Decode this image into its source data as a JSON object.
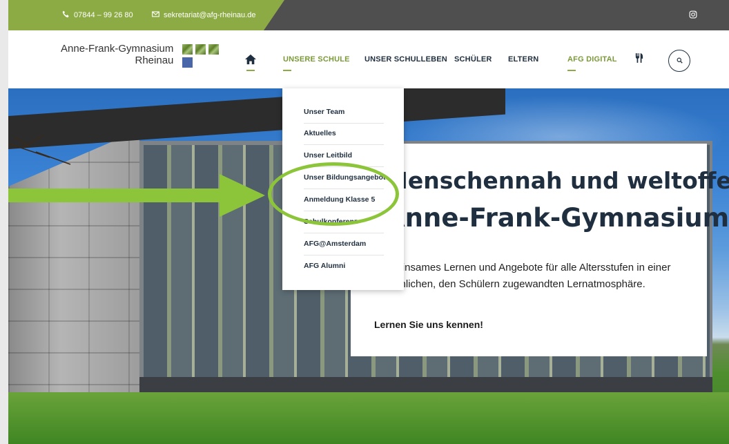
{
  "topbar": {
    "phone": "07844 – 99 26 80",
    "email": "sekretariat@afg-rheinau.de",
    "icons": {
      "phone": "phone-icon",
      "email": "mail-icon",
      "social": "instagram-icon"
    }
  },
  "logo": {
    "line1": "Anne-Frank-Gymnasium",
    "line2": "Rheinau"
  },
  "nav": {
    "home_icon": "home-icon",
    "items": [
      {
        "label": "UNSERE SCHULE",
        "active": true
      },
      {
        "label": "UNSER SCHULLEBEN",
        "active": false
      },
      {
        "label": "SCHÜLER",
        "active": false
      },
      {
        "label": "ELTERN",
        "active": false
      },
      {
        "label": "AFG DIGITAL",
        "active": true
      }
    ],
    "restaurant_icon": "cutlery-icon",
    "search_icon": "search-icon"
  },
  "dropdown": {
    "items": [
      "Unser Team",
      "Aktuelles",
      "Unser Leitbild",
      "Unser Bildungsangebot",
      "Anmeldung Klasse 5",
      "Schulkonferenz",
      "AFG@Amsterdam",
      "AFG Alumni"
    ],
    "highlighted": "Anmeldung Klasse 5"
  },
  "hero": {
    "title_line1": "Menschennah und weltoffen",
    "title_line2": "Anne-Frank-Gymnasium",
    "text": "Gemeinsames Lernen und Angebote für alle Altersstufen in einer persönlichen, den Schülern zugewandten Lernatmosphäre.",
    "cta": "Lernen Sie uns kennen!"
  },
  "colors": {
    "brand_green": "#8dab45",
    "annotation_green": "#8cc43a",
    "topbar": "#4f4f4f",
    "nav_text": "#1f2f3f"
  }
}
